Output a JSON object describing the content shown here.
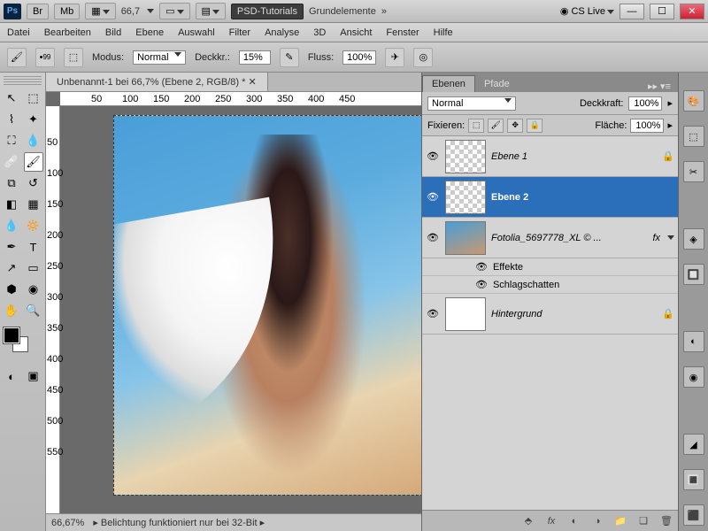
{
  "titlebar": {
    "ps": "Ps",
    "br": "Br",
    "mb": "Mb",
    "zoom": "66,7",
    "cslive": "CS Live",
    "btn_dark1": "PSD-Tutorials",
    "btn_light": "Grundelemente",
    "double_chev": "»"
  },
  "menu": [
    "Datei",
    "Bearbeiten",
    "Bild",
    "Ebene",
    "Auswahl",
    "Filter",
    "Analyse",
    "3D",
    "Ansicht",
    "Fenster",
    "Hilfe"
  ],
  "options": {
    "brush_size": "99",
    "modus_label": "Modus:",
    "modus_value": "Normal",
    "deckkr_label": "Deckkr.:",
    "deckkr_value": "15%",
    "fluss_label": "Fluss:",
    "fluss_value": "100%"
  },
  "doc_tab": "Unbenannt-1 bei 66,7% (Ebene 2, RGB/8) *",
  "ruler_h": [
    "50",
    "100",
    "150",
    "200",
    "250",
    "300",
    "350",
    "400",
    "450"
  ],
  "ruler_v": [
    "50",
    "100",
    "150",
    "200",
    "250",
    "300",
    "350",
    "400",
    "450",
    "500",
    "550"
  ],
  "status": {
    "zoom": "66,67%",
    "msg": "Belichtung funktioniert nur bei 32-Bit"
  },
  "layers_panel": {
    "tab1": "Ebenen",
    "tab2": "Pfade",
    "blend": "Normal",
    "opacity_label": "Deckkraft:",
    "opacity": "100%",
    "fix_label": "Fixieren:",
    "fill_label": "Fläche:",
    "fill": "100%",
    "layers": [
      {
        "name": "Ebene 1",
        "locked": true
      },
      {
        "name": "Ebene 2",
        "selected": true
      },
      {
        "name": "Fotolia_5697778_XL © ...",
        "fx": true
      },
      {
        "name": "Hintergrund",
        "locked": true,
        "bg": true
      }
    ],
    "fx1": "Effekte",
    "fx2": "Schlagschatten"
  }
}
